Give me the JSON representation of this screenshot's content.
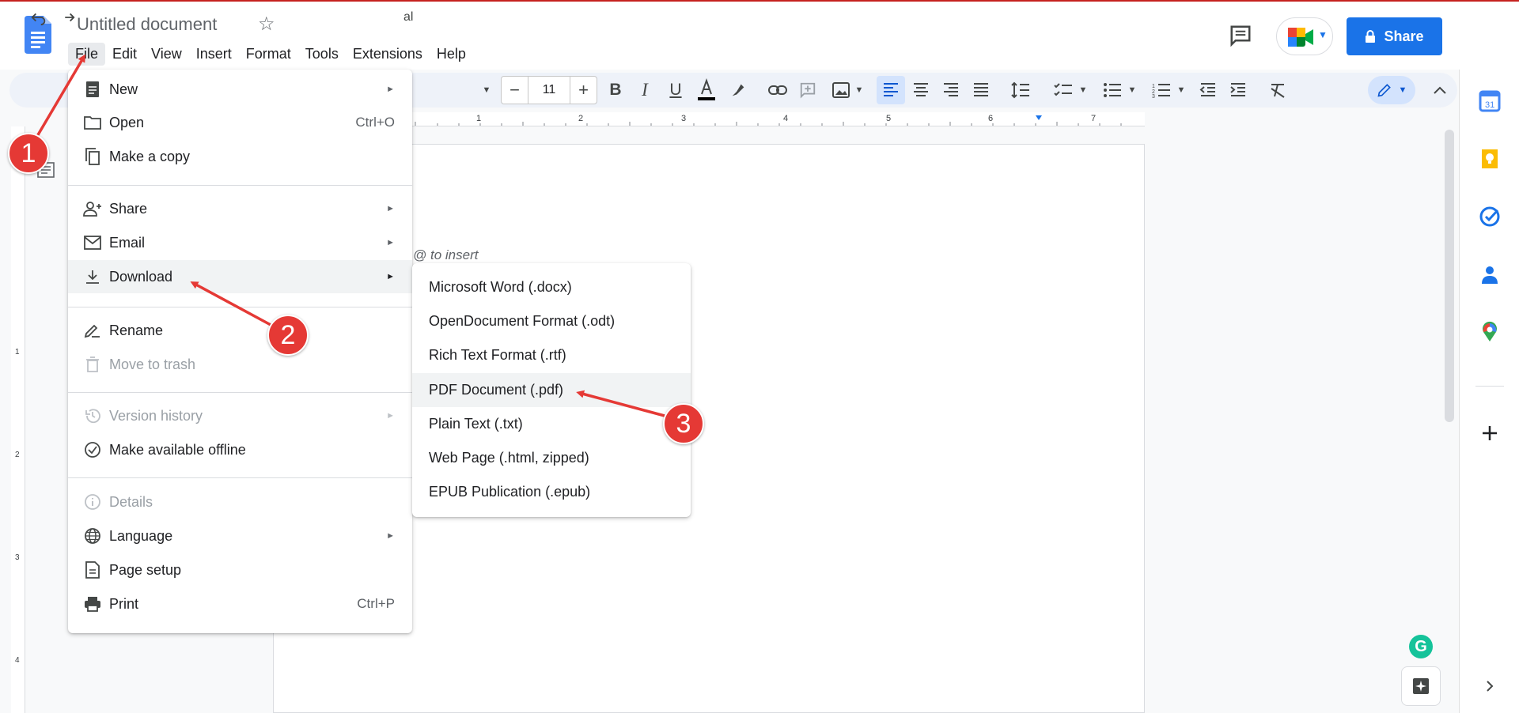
{
  "app": {
    "doc_title": "Untitled document",
    "share_label": "Share"
  },
  "menubar": [
    "File",
    "Edit",
    "View",
    "Insert",
    "Format",
    "Tools",
    "Extensions",
    "Help"
  ],
  "toolbar": {
    "font_name": "al",
    "font_size": "11",
    "minus": "−",
    "plus": "+"
  },
  "document": {
    "placeholder": "@ to insert"
  },
  "ruler": {
    "h_labels": [
      "1",
      "2",
      "3",
      "4",
      "5",
      "6",
      "7"
    ],
    "v_labels": [
      "1",
      "2",
      "3",
      "4"
    ]
  },
  "file_menu": {
    "items": [
      {
        "label": "New",
        "icon": "document-icon",
        "submenu": true
      },
      {
        "label": "Open",
        "icon": "folder-icon",
        "shortcut": "Ctrl+O"
      },
      {
        "label": "Make a copy",
        "icon": "copy-icon"
      },
      {
        "label": "Share",
        "icon": "person-add-icon",
        "submenu": true
      },
      {
        "label": "Email",
        "icon": "email-icon",
        "submenu": true
      },
      {
        "label": "Download",
        "icon": "download-icon",
        "submenu": true
      },
      {
        "label": "Rename",
        "icon": "rename-icon"
      },
      {
        "label": "Move to trash",
        "icon": "trash-icon",
        "disabled": true
      },
      {
        "label": "Version history",
        "icon": "history-icon",
        "submenu": true,
        "disabled": true
      },
      {
        "label": "Make available offline",
        "icon": "offline-check-icon"
      },
      {
        "label": "Details",
        "icon": "info-icon",
        "disabled": true
      },
      {
        "label": "Language",
        "icon": "globe-icon",
        "submenu": true
      },
      {
        "label": "Page setup",
        "icon": "page-icon"
      },
      {
        "label": "Print",
        "icon": "printer-icon",
        "shortcut": "Ctrl+P"
      }
    ],
    "submenu_arrow": "►"
  },
  "download_submenu": {
    "items": [
      "Microsoft Word (.docx)",
      "OpenDocument Format (.odt)",
      "Rich Text Format (.rtf)",
      "PDF Document (.pdf)",
      "Plain Text (.txt)",
      "Web Page (.html, zipped)",
      "EPUB Publication (.epub)"
    ]
  },
  "annotations": {
    "step1": "1",
    "step2": "2",
    "step3": "3",
    "color": "#e53935"
  },
  "colors": {
    "accent": "#1a73e8",
    "menu_highlight": "#f1f3f4",
    "disabled_text": "#9aa0a6"
  }
}
